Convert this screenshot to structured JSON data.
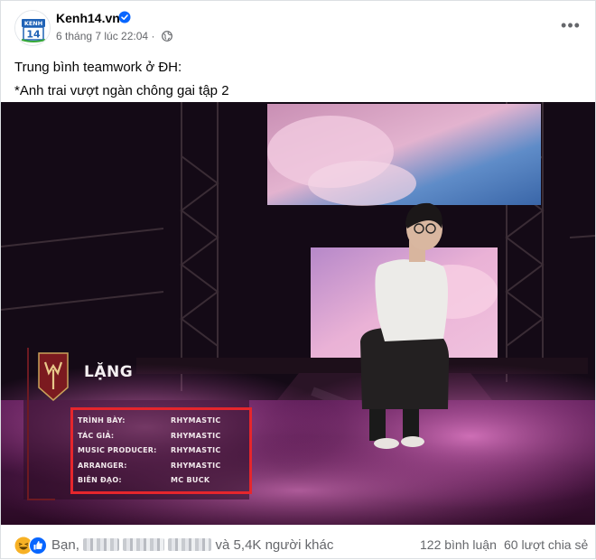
{
  "post": {
    "page_name": "Kenh14.vn",
    "timestamp": "6 tháng 7 lúc 22:04",
    "privacy_icon": "globe-icon",
    "verified_icon": "verified-badge-icon",
    "more_icon": "more-options-icon",
    "caption_line1": "Trung bình teamwork ở ĐH:",
    "caption_line2": "*Anh trai vượt ngàn chông gai tập 2"
  },
  "avatar": {
    "brand_text": "KENH",
    "brand_number": "14"
  },
  "video_overlay": {
    "song_title": "LẶNG",
    "credits": [
      {
        "role": "TRÌNH BÀY:",
        "name": "RHYMASTIC"
      },
      {
        "role": "TÁC GIẢ:",
        "name": "RHYMASTIC"
      },
      {
        "role": "MUSIC PRODUCER:",
        "name": "RHYMASTIC"
      },
      {
        "role": "ARRANGER:",
        "name": "RHYMASTIC"
      },
      {
        "role": "BIÊN ĐẠO:",
        "name": "MC BUCK"
      }
    ],
    "highlight_color": "#e6262c"
  },
  "footer": {
    "reactions": [
      "haha-icon",
      "like-icon"
    ],
    "reactors_prefix": "Bạn,",
    "reactors_suffix": "và 5,4K người khác",
    "comments": "122 bình luận",
    "shares": "60 lượt chia sẻ"
  },
  "colors": {
    "secondary_text": "#65676b",
    "verified": "#0866ff"
  }
}
